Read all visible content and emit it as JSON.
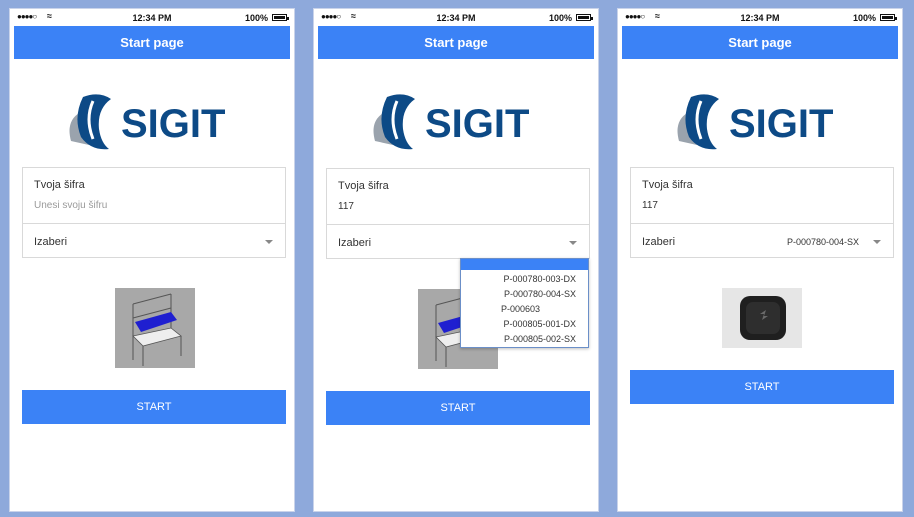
{
  "status_bar": {
    "time": "12:34 PM",
    "battery": "100%",
    "signal": "●●●●○",
    "wifi": "≈"
  },
  "screens": [
    {
      "nav_title": "Start page",
      "code_label": "Tvoja šifra",
      "code_placeholder": "Unesi svoju šifru",
      "code_value": "",
      "select_label": "Izaberi",
      "select_value": "",
      "start_label": "START",
      "image": "workbench-image"
    },
    {
      "nav_title": "Start page",
      "code_label": "Tvoja šifra",
      "code_value": "117",
      "select_label": "Izaberi",
      "select_value": "",
      "start_label": "START",
      "image": "workbench-image",
      "dropdown_options": [
        "",
        "P-000780-003-DX",
        "P-000780-004-SX",
        "P-000603",
        "P-000805-001-DX",
        "P-000805-002-SX"
      ]
    },
    {
      "nav_title": "Start page",
      "code_label": "Tvoja šifra",
      "code_value": "117",
      "select_label": "Izaberi",
      "select_value": "P-000780-004-SX",
      "start_label": "START",
      "image": "switch-button-image"
    }
  ],
  "logo_text": "SIGIT",
  "colors": {
    "accent": "#3b82f6",
    "logo_blue": "#0d4a86",
    "logo_grey": "#9aa3ad",
    "background": "#8ea9db"
  }
}
